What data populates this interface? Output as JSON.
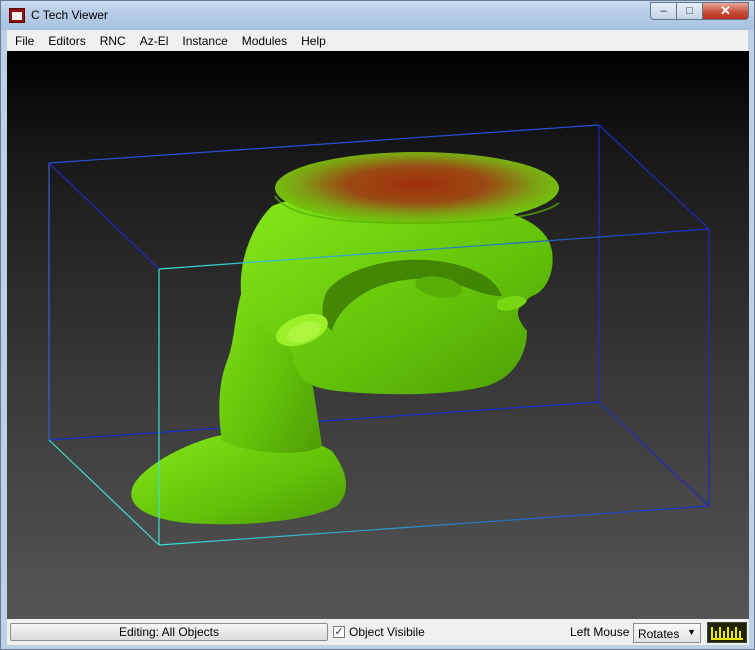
{
  "window": {
    "title": "C Tech Viewer",
    "app_icon_text": "Tech",
    "minimize_glyph": "–",
    "maximize_glyph": "□",
    "close_glyph": "✕"
  },
  "menu": [
    "File",
    "Editors",
    "RNC",
    "Az-El",
    "Instance",
    "Modules",
    "Help"
  ],
  "status": {
    "editing_label": "Editing: All Objects",
    "object_visible_label": "Object Visibile",
    "object_visible_checked": true,
    "check_glyph": "✓",
    "left_mouse_label": "Left Mouse",
    "left_mouse_mode": "Rotates",
    "dropdown_glyph": "▼"
  },
  "scene": {
    "background_top": "#000000",
    "background_bottom": "#555555",
    "isosurface_color": "#6ed10a",
    "hotspot_color": "#a03010",
    "bbox_color_a": "#1a2cc8",
    "bbox_color_b": "#3ce0d0"
  }
}
